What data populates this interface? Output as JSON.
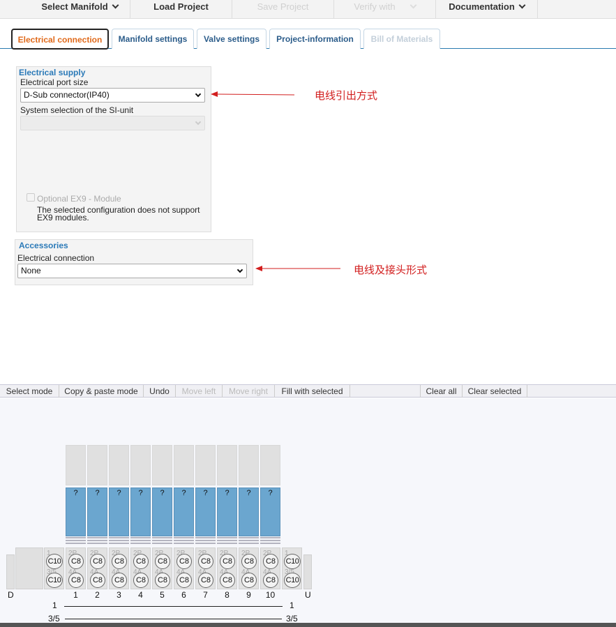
{
  "topbar": {
    "select_manifold": "Select Manifold",
    "load_project": "Load Project",
    "save_project": "Save Project",
    "verify_with": "Verify with",
    "documentation": "Documentation"
  },
  "tabs": [
    {
      "label": "Electrical connection"
    },
    {
      "label": "Manifold settings"
    },
    {
      "label": "Valve settings"
    },
    {
      "label": "Project-information"
    },
    {
      "label": "Bill of Materials"
    }
  ],
  "electrical_supply": {
    "title": "Electrical supply",
    "port_size_label": "Electrical port size",
    "port_size_value": "D-Sub connector(IP40)",
    "si_unit_label": "System selection of the SI-unit",
    "si_unit_value": "",
    "ex9_label": "Optional EX9 - Module",
    "ex9_note_line1": "The selected configuration does not support",
    "ex9_note_line2": "EX9 modules."
  },
  "accessories": {
    "title": "Accessories",
    "connection_label": "Electrical connection",
    "connection_value": "None"
  },
  "annotations": {
    "port": "电线引出方式",
    "connection": "电线及接头形式"
  },
  "toolbar": {
    "select_mode": "Select mode",
    "copy_paste": "Copy & paste mode",
    "undo": "Undo",
    "move_left": "Move left",
    "move_right": "Move right",
    "fill_selected": "Fill with selected",
    "clear_all": "Clear all",
    "clear_selected": "Clear selected"
  },
  "manifold": {
    "valve_mark": "?",
    "stations": [
      "1",
      "2",
      "3",
      "4",
      "5",
      "6",
      "7",
      "8",
      "9",
      "10"
    ],
    "sub_top_label": "2P",
    "sub_bot_label": "4A",
    "end_top_label": "1",
    "end_bot_label": "3/5",
    "station_circle": "C8",
    "end_circle": "C10",
    "left_end": "D",
    "right_end": "U",
    "line1_left": "1",
    "line1_right": "1",
    "line2_left": "3/5",
    "line2_right": "3/5"
  },
  "colors": {
    "active_tab": "#e06a1b",
    "tab_text": "#2b5c8a",
    "group_title": "#2b7ab8",
    "valve": "#6ba6cf",
    "annotation": "#d21e1e"
  }
}
